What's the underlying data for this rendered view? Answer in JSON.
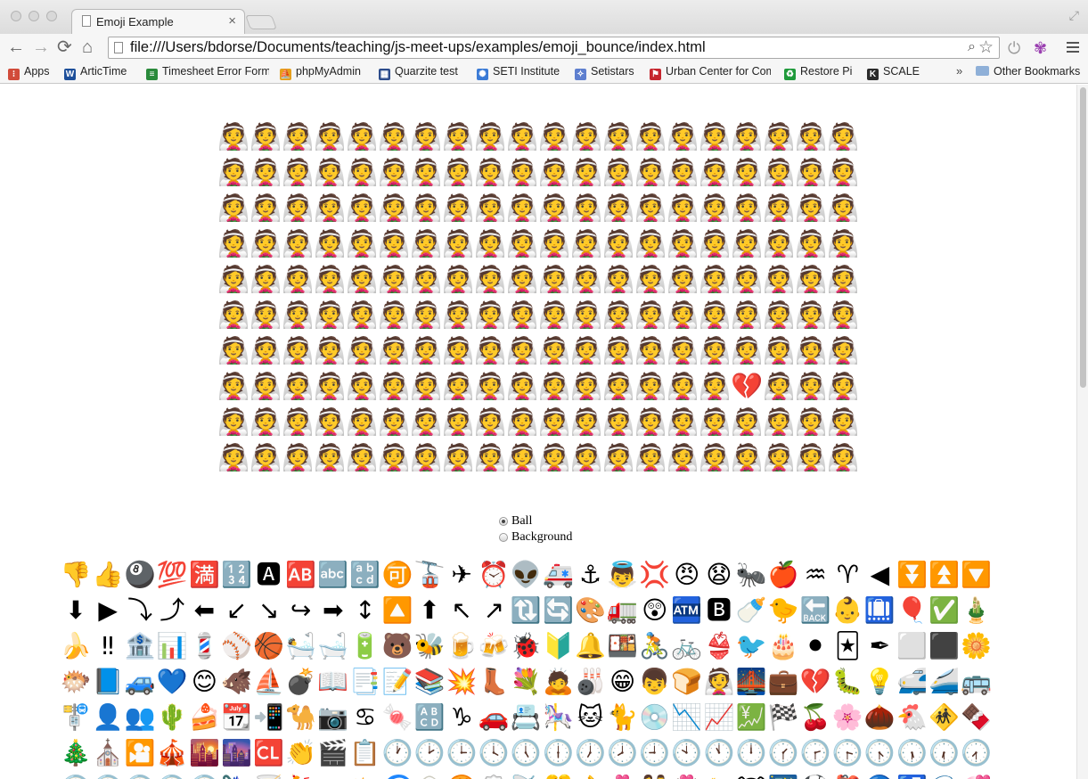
{
  "browser": {
    "tab_title": "Emoji Example",
    "tab_close": "×",
    "url": "file:///Users/bdorse/Documents/teaching/js-meet-ups/examples/emoji_bounce/index.html",
    "nav": {
      "back": "←",
      "forward": "→",
      "reload": "⟳",
      "home": "⌂"
    },
    "bookmarks": [
      {
        "label": "Apps",
        "icon": "apps-grid-icon",
        "color": "#d14b3a"
      },
      {
        "label": "ArticTime",
        "icon": "w-logo-icon",
        "color": "#1d4f9a"
      },
      {
        "label": "Timesheet Error Form",
        "icon": "sheet-icon",
        "color": "#2a8a3b"
      },
      {
        "label": "phpMyAdmin",
        "icon": "pma-icon",
        "color": "#e69f1c"
      },
      {
        "label": "Quarzite test",
        "icon": "grid-icon",
        "color": "#2c4c8c"
      },
      {
        "label": "SETI Institute",
        "icon": "seti-icon",
        "color": "#3b7bd6"
      },
      {
        "label": "Setistars",
        "icon": "stars-icon",
        "color": "#5e7fcf"
      },
      {
        "label": "Urban Center for Computation",
        "icon": "flag-icon",
        "color": "#c6262e"
      },
      {
        "label": "Restore Pi",
        "icon": "recycle-icon",
        "color": "#1f9a3b"
      },
      {
        "label": "SCALE",
        "icon": "k-icon",
        "color": "#2b2b2b"
      }
    ],
    "bookmarks_more": "»",
    "other_bookmarks": "Other Bookmarks"
  },
  "game_grid": {
    "rows": 10,
    "cols": 20,
    "tile_emoji": "👰",
    "special_emoji": "💔",
    "special_row": 7,
    "special_col": 16
  },
  "radio_options": [
    {
      "label": "Ball",
      "checked": true
    },
    {
      "label": "Background",
      "checked": false
    }
  ],
  "palette_rows": [
    [
      "👎",
      "👍",
      "🎱",
      "💯",
      "🈵",
      "🔢",
      "🅰",
      "🆎",
      "🔤",
      "🔡",
      "🉑",
      "🚡",
      "✈",
      "⏰",
      "👽",
      "🚑",
      "⚓",
      "👼",
      "💢",
      "😠",
      "😧",
      "🐜",
      "🍎",
      "♒",
      "♈",
      "◀",
      "⏬",
      "⏫",
      "🔽"
    ],
    [
      "⬇",
      "▶",
      "⤵",
      "⤴",
      "⬅",
      "↙",
      "↘",
      "↪",
      "➡",
      "↕",
      "🔼",
      "⬆",
      "↖",
      "↗",
      "🔃",
      "🔄",
      "🎨",
      "🚛",
      "😲",
      "🏧",
      "🅱",
      "🍼",
      "🐤",
      "🔙",
      "👶",
      "🛄",
      "🎈",
      "✅",
      "🎍"
    ],
    [
      "🍌",
      "‼",
      "🏦",
      "📊",
      "💈",
      "⚾",
      "🏀",
      "🛀",
      "🛁",
      "🔋",
      "🐻",
      "🐝",
      "🍺",
      "🍻",
      "🐞",
      "🔰",
      "🔔",
      "🍱",
      "🚴",
      "🚲",
      "👙",
      "🐦",
      "🎂",
      "⚫",
      "🃏",
      "✒",
      "⬜",
      "⬛",
      "🌼"
    ],
    [
      "🐡",
      "📘",
      "🚙",
      "💙",
      "😊",
      "🐗",
      "⛵",
      "💣",
      "📖",
      "📑",
      "📝",
      "📚",
      "💥",
      "👢",
      "💐",
      "🙇",
      "🎳",
      "😁",
      "👦",
      "🍞",
      "👰",
      "🌉",
      "💼",
      "💔",
      "🐛",
      "💡",
      "🚅",
      "🚄",
      "🚌"
    ],
    [
      "🚏",
      "👤",
      "👥",
      "🌵",
      "🍰",
      "📆",
      "📲",
      "🐪",
      "📷",
      "♋",
      "🍬",
      "🔠",
      "♑",
      "🚗",
      "📇",
      "🎠",
      "🐱",
      "🐈",
      "💿",
      "📉",
      "📈",
      "💹",
      "🏁",
      "🍒",
      "🌸",
      "🌰",
      "🐔",
      "🚸",
      "🍫"
    ],
    [
      "🎄",
      "⛪",
      "🎦",
      "🎪",
      "🌇",
      "🌆",
      "🆑",
      "👏",
      "🎬",
      "📋",
      "🕐",
      "🕑",
      "🕒",
      "🕓",
      "🕔",
      "🕕",
      "🕖",
      "🕗",
      "🕘",
      "🕙",
      "🕚",
      "🕛",
      "🕜",
      "🕝",
      "🕞",
      "🕟",
      "🕠",
      "🕡",
      "🕢"
    ],
    [
      "🕣",
      "🕤",
      "🕥",
      "🕦",
      "🕧",
      "🌂",
      "🍸",
      "🍹",
      "☁",
      "⛅",
      "🌀",
      "🍙",
      "🍘",
      "🍥",
      "📡",
      "🎊",
      "👌",
      "💑",
      "👫",
      "💏",
      "🐄",
      "🐮",
      "🌃",
      "⚽",
      "🎒",
      "🔵",
      "🛃",
      "🌊",
      "💞"
    ]
  ]
}
